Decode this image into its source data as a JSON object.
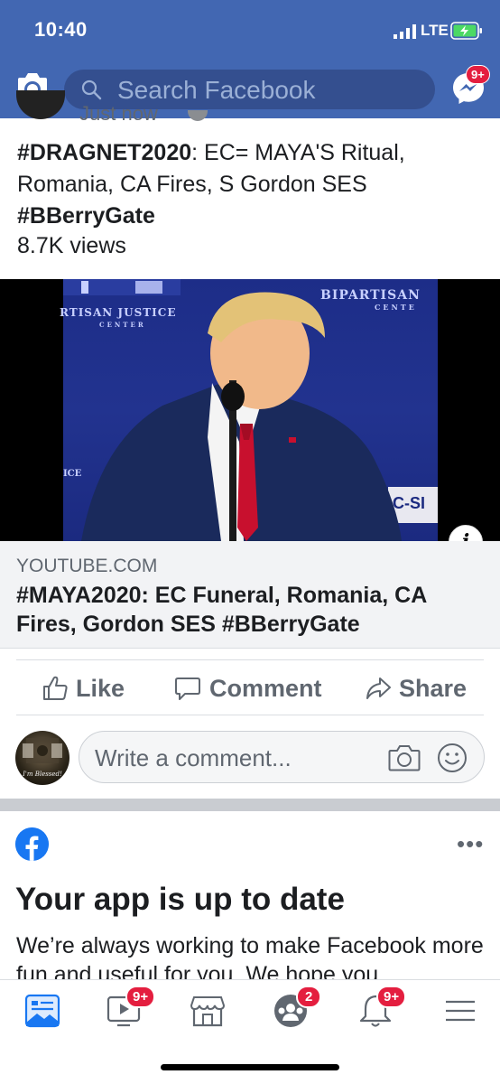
{
  "status_bar": {
    "time": "10:40",
    "network": "LTE"
  },
  "header": {
    "search_placeholder": "Search Facebook",
    "messenger_badge": "9+",
    "brand_color": "#4267b2"
  },
  "post": {
    "meta": "Just now",
    "text_hashtag": "#DRAGNET2020",
    "text_rest": ": EC= MAYA'S Ritual, Romania, CA Fires, S Gordon SES ",
    "text_hashtag2": "#BBerryGate",
    "views": "8.7K views",
    "video": {
      "overlay_text_1": "BIPARTISAN",
      "overlay_text_2": "CENTE",
      "overlay_text_3": "RTISAN JUSTICE",
      "overlay_text_4": "CENTER",
      "overlay_text_5": "ICE",
      "overlay_text_6": "C-SI",
      "info_label": "i"
    },
    "link": {
      "domain": "YOUTUBE.COM",
      "title": "#MAYA2020: EC Funeral, Romania, CA Fires, Gordon SES #BBerryGate"
    },
    "actions": {
      "like": "Like",
      "comment": "Comment",
      "share": "Share"
    },
    "comment_placeholder": "Write a comment...",
    "commenter_avatar_caption": "I'm Blessed!"
  },
  "update_card": {
    "more": "•••",
    "title": "Your app is up to date",
    "body": "We’re always working to make Facebook more fun and useful for you. We hope you"
  },
  "tabbar": {
    "video_badge": "9+",
    "groups_badge": "2",
    "notifications_badge": "9+"
  }
}
